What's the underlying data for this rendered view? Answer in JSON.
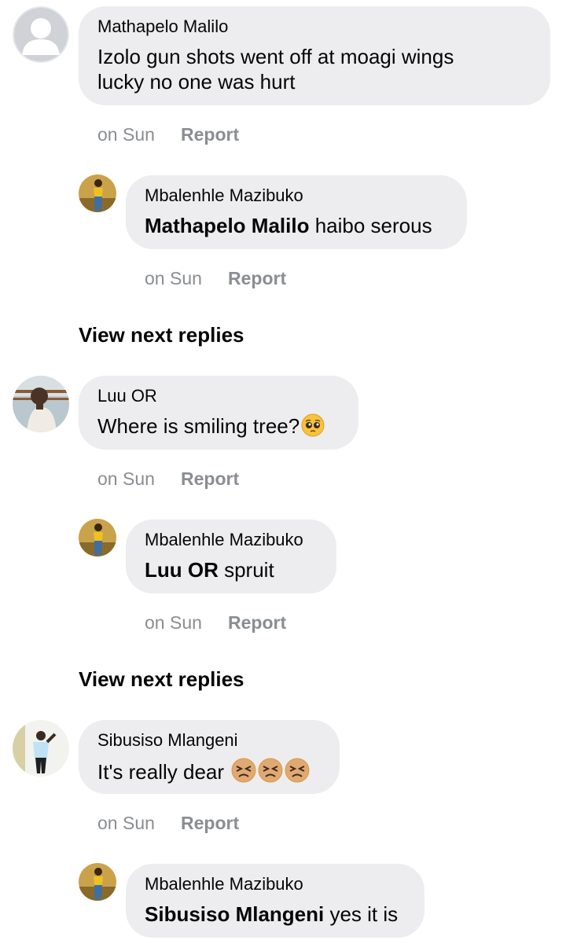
{
  "comments": [
    {
      "author": "Mathapelo Malilo",
      "text_line1": "Izolo gun shots went off at moagi wings",
      "text_line2": "lucky no one was hurt",
      "time": "on Sun",
      "report": "Report",
      "avatar": "default-avatar-icon",
      "reply": {
        "author": "Mbalenhle Mazibuko",
        "mention": "Mathapelo Malilo",
        "text": " haibo serous",
        "time": "on Sun",
        "report": "Report"
      }
    },
    {
      "author": "Luu OR",
      "text": "Where is smiling tree?",
      "emoji": [
        "pleading-face-emoji"
      ],
      "time": "on Sun",
      "report": "Report",
      "reply": {
        "author": "Mbalenhle Mazibuko",
        "mention": "Luu OR",
        "text": " spruit",
        "time": "on Sun",
        "report": "Report"
      }
    },
    {
      "author": "Sibusiso Mlangeni",
      "text": "It's really dear ",
      "emoji": [
        "tired-face-emoji",
        "tired-face-emoji",
        "tired-face-emoji"
      ],
      "time": "on Sun",
      "report": "Report",
      "reply": {
        "author": "Mbalenhle Mazibuko",
        "mention": "Sibusiso Mlangeni",
        "text": " yes it is",
        "time": "on Sun",
        "report": "Report"
      }
    }
  ],
  "view_next_replies": [
    "View next replies",
    "View next replies"
  ],
  "colors": {
    "bubble": "#ededf0",
    "meta_text": "#8a8d91",
    "text": "#050505"
  }
}
